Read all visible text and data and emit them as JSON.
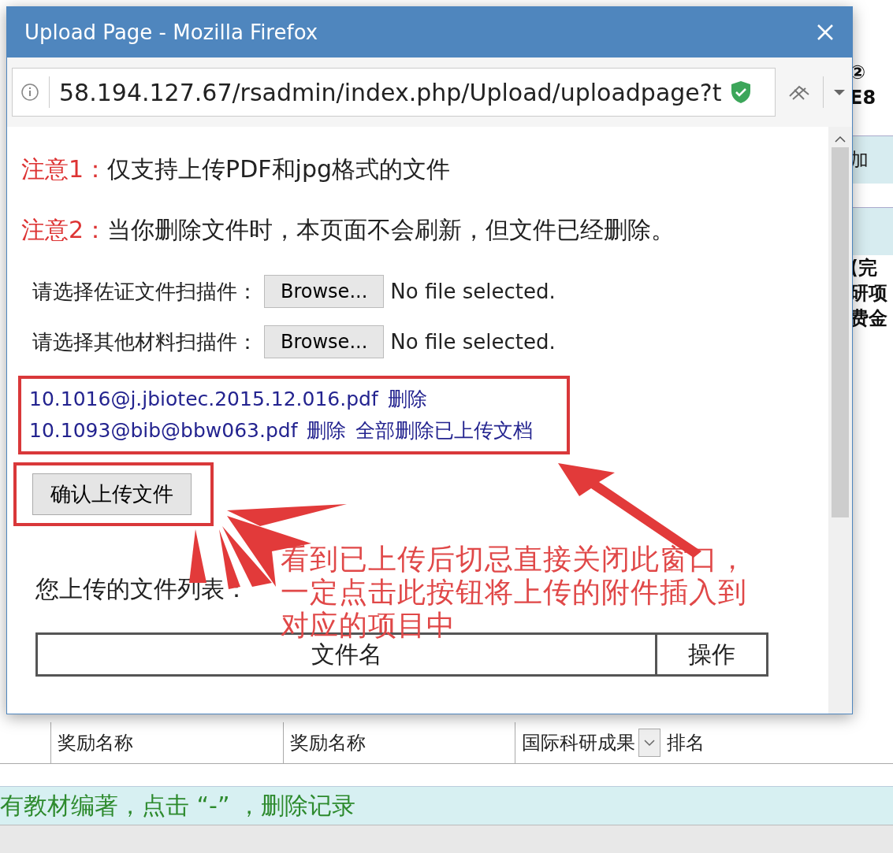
{
  "window": {
    "title": "Upload Page - Mozilla Firefox"
  },
  "address_bar": {
    "url": "58.194.127.67/rsadmin/index.php/Upload/uploadpage?t"
  },
  "notes": [
    {
      "label": "注意1：",
      "text": "仅支持上传PDF和jpg格式的文件"
    },
    {
      "label": "注意2：",
      "text": "当你删除文件时，本页面不会刷新，但文件已经删除。"
    }
  ],
  "file_inputs": [
    {
      "label": "请选择佐证文件扫描件：",
      "button": "Browse...",
      "status": "No file selected."
    },
    {
      "label": "请选择其他材料扫描件：",
      "button": "Browse...",
      "status": "No file selected."
    }
  ],
  "uploaded_files": [
    {
      "name": "10.1016@j.jbiotec.2015.12.016.pdf",
      "delete": "删除"
    },
    {
      "name": "10.1093@bib@bbw063.pdf",
      "delete": "删除"
    }
  ],
  "delete_all": "全部删除已上传文档",
  "confirm_button": "确认上传文件",
  "file_list": {
    "title": "您上传的文件列表：",
    "columns": [
      "文件名",
      "操作"
    ]
  },
  "annotation": "看到已上传后切忌直接关闭此窗口，一定点击此按钮将上传的附件插入到对应的项目中",
  "background": {
    "side": [
      {
        "kind": "text",
        "text": "②"
      },
      {
        "kind": "text",
        "text": "E8"
      },
      {
        "kind": "band",
        "text": "加"
      },
      {
        "kind": "band"
      },
      {
        "kind": "text",
        "text": "(完"
      },
      {
        "kind": "text",
        "text": "研项"
      },
      {
        "kind": "text",
        "text": "费金"
      }
    ],
    "row": {
      "cells": [
        "奖励名称",
        "奖励名称"
      ],
      "select": "国际科研成果",
      "last": "排名"
    },
    "notice": "有教材编著，点击 “-” ，删除记录"
  }
}
